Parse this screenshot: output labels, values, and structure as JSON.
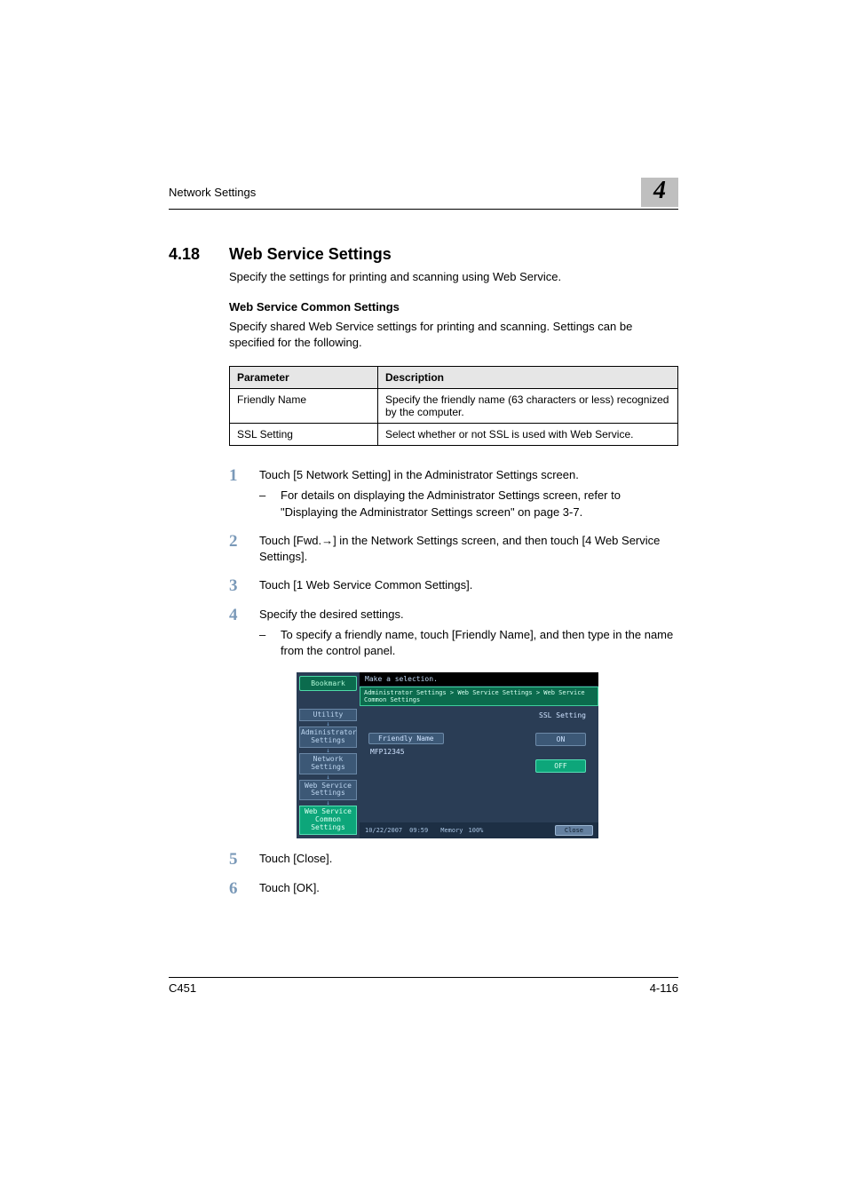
{
  "header": {
    "running_title": "Network Settings",
    "chapter": "4"
  },
  "section": {
    "number": "4.18",
    "title": "Web Service Settings",
    "intro": "Specify the settings for printing and scanning using Web Service."
  },
  "subsection": {
    "title": "Web Service Common Settings",
    "desc": "Specify shared Web Service settings for printing and scanning. Settings can be specified for the following."
  },
  "table": {
    "head_param": "Parameter",
    "head_desc": "Description",
    "rows": [
      {
        "param": "Friendly Name",
        "desc": "Specify the friendly name (63 characters or less) recognized by the computer."
      },
      {
        "param": "SSL Setting",
        "desc": "Select whether or not SSL is used with Web Service."
      }
    ]
  },
  "steps": {
    "s1": "Touch [5 Network Setting] in the Administrator Settings screen.",
    "s1_sub": "For details on displaying the Administrator Settings screen, refer to \"Displaying the Administrator Settings screen\" on page 3-7.",
    "s2": "Touch [Fwd.→] in the Network Settings screen, and then touch [4 Web Service Settings].",
    "s3": "Touch [1 Web Service Common Settings].",
    "s4": "Specify the desired settings.",
    "s4_sub": "To specify a friendly name, touch [Friendly Name], and then type in the name from the control panel.",
    "s5": "Touch [Close].",
    "s6": "Touch [OK]."
  },
  "step_numbers": {
    "n1": "1",
    "n2": "2",
    "n3": "3",
    "n4": "4",
    "n5": "5",
    "n6": "6"
  },
  "bullet_dash": "–",
  "touchscreen": {
    "top_msg": "Make a selection.",
    "breadcrumb": "Administrator Settings > Web Service Settings > Web Service Common Settings",
    "bookmark": "Bookmark",
    "nav": {
      "utility": "Utility",
      "admin": "Administrator Settings",
      "network": "Network Settings",
      "webservice": "Web Service Settings",
      "common": "Web Service Common Settings"
    },
    "ssl_label": "SSL Setting",
    "friendly_label": "Friendly Name",
    "friendly_value": "MFP12345",
    "on": "ON",
    "off": "OFF",
    "date": "10/22/2007",
    "time": "09:59",
    "memory_label": "Memory",
    "memory_val": "100%",
    "close": "Close"
  },
  "footer": {
    "model": "C451",
    "page": "4-116"
  }
}
